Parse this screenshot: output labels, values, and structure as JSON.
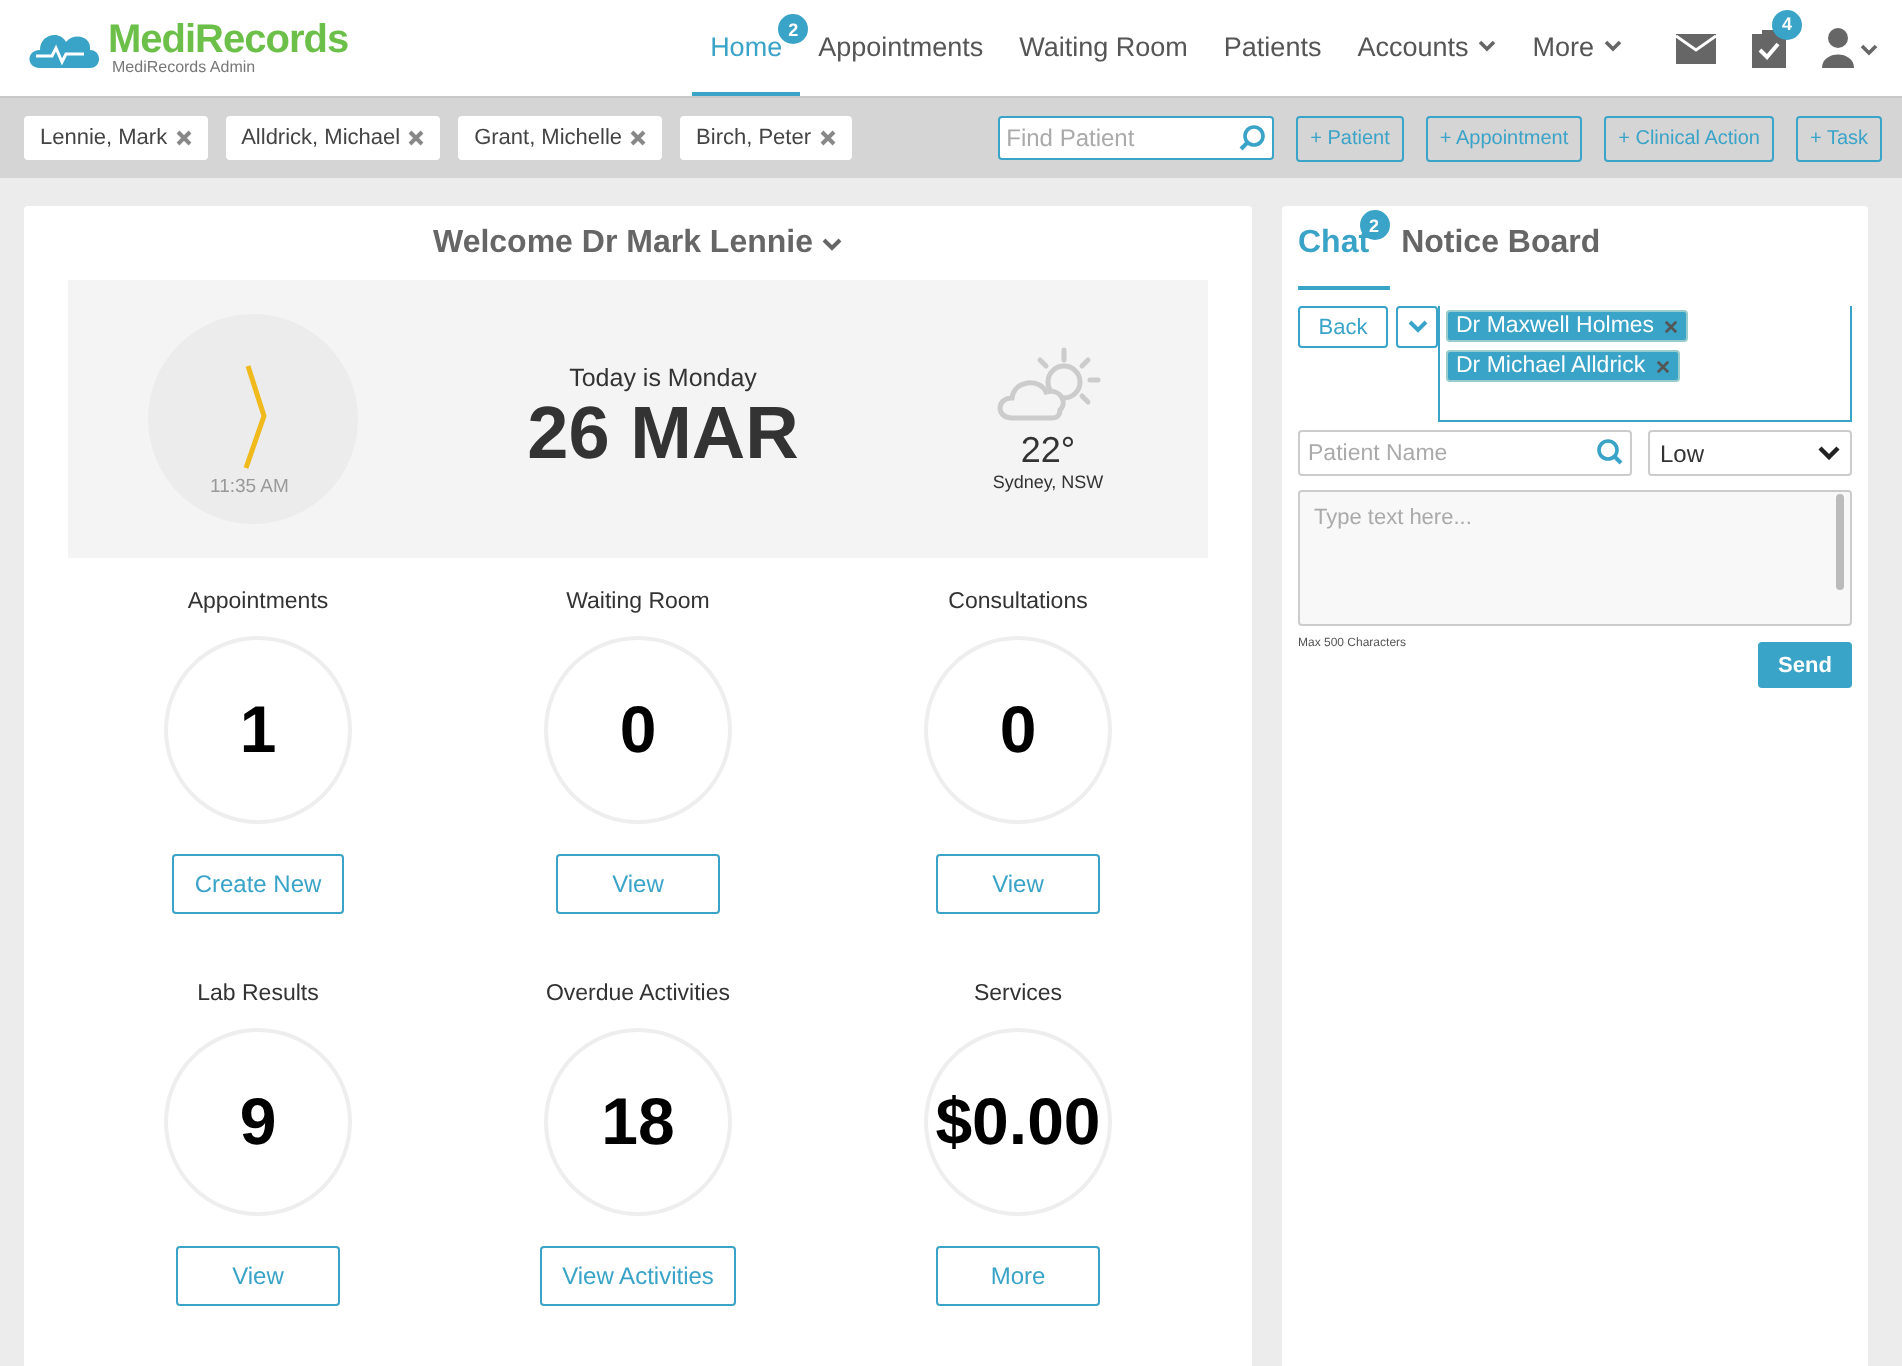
{
  "brand": {
    "name": "MediRecords",
    "subtitle": "MediRecords Admin"
  },
  "nav": [
    {
      "label": "Home",
      "selected": true,
      "badge": "2",
      "dropdown": false
    },
    {
      "label": "Appointments",
      "selected": false,
      "dropdown": false
    },
    {
      "label": "Waiting Room",
      "selected": false,
      "dropdown": false
    },
    {
      "label": "Patients",
      "selected": false,
      "dropdown": false
    },
    {
      "label": "Accounts",
      "selected": false,
      "dropdown": true
    },
    {
      "label": "More",
      "selected": false,
      "dropdown": true
    }
  ],
  "header_icons": [
    {
      "kind": "mail"
    },
    {
      "kind": "tasks",
      "badge": "4"
    },
    {
      "kind": "user"
    }
  ],
  "patient_tabs": [
    "Lennie, Mark",
    "Alldrick, Michael",
    "Grant, Michelle",
    "Birch, Peter"
  ],
  "find_patient": {
    "placeholder": "Find Patient"
  },
  "quick_actions": [
    "+ Patient",
    "+ Appointment",
    "+ Clinical Action",
    "+ Task"
  ],
  "welcome": "Welcome Dr Mark Lennie",
  "today": {
    "time": "11:35 AM",
    "day_text": "Today is Monday",
    "date": "26 MAR",
    "temperature": "22°",
    "location": "Sydney, NSW"
  },
  "stats": [
    {
      "label": "Appointments",
      "value": "1",
      "action": "Create New"
    },
    {
      "label": "Waiting Room",
      "value": "0",
      "action": "View"
    },
    {
      "label": "Consultations",
      "value": "0",
      "action": "View"
    },
    {
      "label": "Lab Results",
      "value": "9",
      "action": "View"
    },
    {
      "label": "Overdue Activities",
      "value": "18",
      "action": "View Activities"
    },
    {
      "label": "Services",
      "value": "$0.00",
      "action": "More"
    }
  ],
  "side_tabs": [
    {
      "label": "Chat",
      "selected": true,
      "badge": "2"
    },
    {
      "label": "Notice Board",
      "selected": false
    }
  ],
  "chat": {
    "back": "Back",
    "recipients": [
      "Dr Maxwell Holmes",
      "Dr Michael Alldrick"
    ],
    "patient_placeholder": "Patient Name",
    "priority": "Low",
    "message_placeholder": "Type text here...",
    "limit_note": "Max 500 Characters",
    "send": "Send"
  }
}
